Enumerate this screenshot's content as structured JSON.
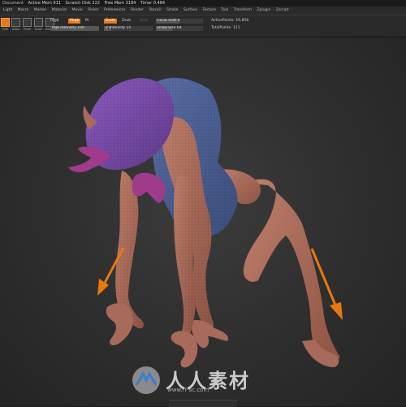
{
  "titlebar": {
    "app_menu": "Document",
    "stats": [
      "Active Mem 911",
      "Scratch Disk 222",
      "Free Mem 3184",
      "Timer 0.484"
    ]
  },
  "menubar": {
    "items": [
      "Light",
      "Macro",
      "Marker",
      "Material",
      "Movie",
      "Picker",
      "Preferences",
      "Render",
      "Stencil",
      "Stroke",
      "Surface",
      "Texture",
      "Tool",
      "Transform",
      "Zplugin",
      "Zscript"
    ]
  },
  "toolbar": {
    "tools": [
      "Edit",
      "Draw",
      "Move",
      "Scale",
      "Rotate"
    ],
    "active_tool": "Edit",
    "rgb_label": "Rrgb",
    "mrgb_label": "Mrgb",
    "m_label": "M",
    "zadd_label": "Zadd",
    "zsub_label": "Zsub",
    "zcut_label": "Zcut",
    "rgb_intensity": {
      "label": "Rgb Intensity",
      "value": "100",
      "fraction": 1.0
    },
    "z_intensity": {
      "label": "Z Intensity",
      "value": "15",
      "fraction": 0.15
    },
    "focal_shift": {
      "label": "Focal Shift",
      "value": "0",
      "fraction": 0.5
    },
    "draw_size": {
      "label": "Draw Size",
      "value": "64",
      "fraction": 0.35
    },
    "active_points": {
      "label": "ActivePoints:",
      "value": "19,858"
    },
    "total_points": {
      "label": "TotalPoints:",
      "value": "111"
    }
  },
  "watermark": {
    "text": "人人素材",
    "subtext": "www.rr-sc.com"
  },
  "colors": {
    "accent": "#e87a13",
    "arrow": "#e8780f",
    "creature_skin": "#a86a5a",
    "armor_blue": "#4a5d8c",
    "head_purple": "#7a4fa8",
    "mouth_magenta": "#a03a8a"
  }
}
